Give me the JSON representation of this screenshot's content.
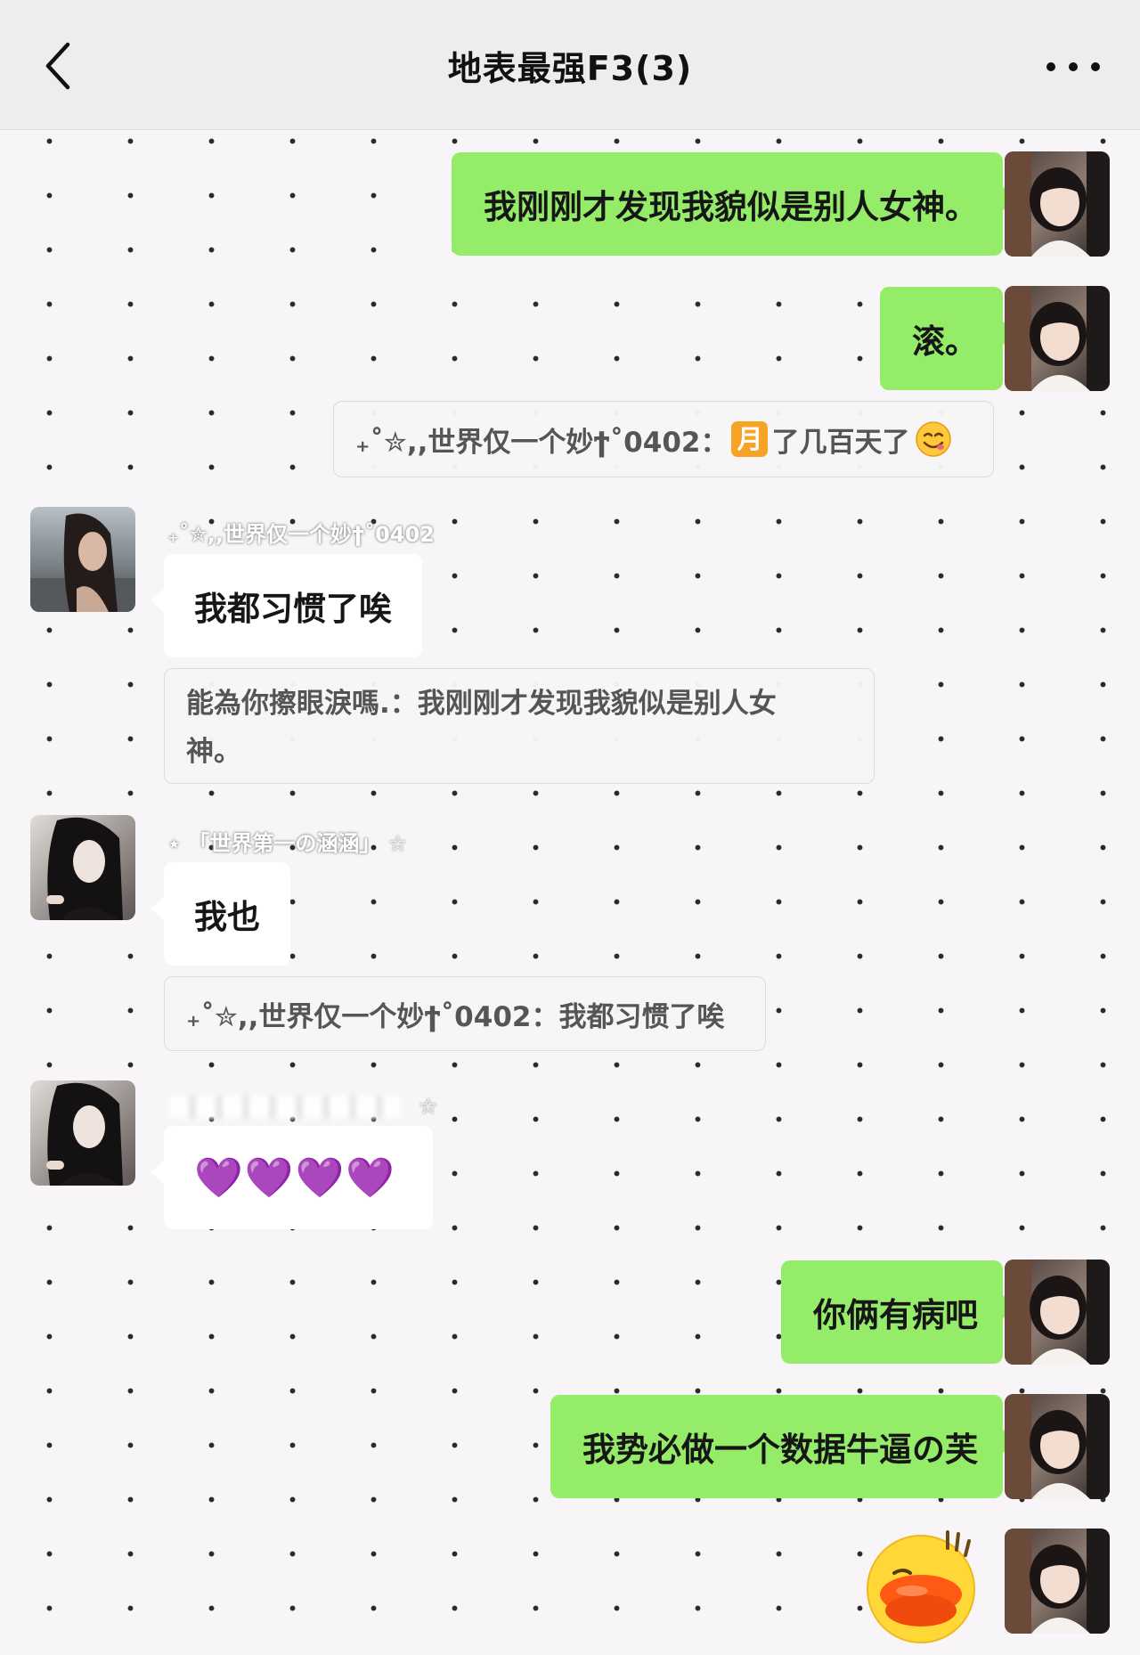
{
  "header": {
    "title": "地表最强F3(3)"
  },
  "messages": {
    "m1": {
      "text": "我刚刚才发现我貌似是别人女神。"
    },
    "m2": {
      "text": "滚。"
    },
    "m3": {
      "quote_prefix": "₊˚✮,,世界仅一个妙ϯ˚0402：",
      "quote_badge": "月",
      "quote_suffix": "了几百天了",
      "quote_emoji": "smiling-face-icon"
    },
    "m4": {
      "sender": "₊˚✮,,世界仅一个妙ϯ˚0402",
      "text": "我都习惯了唉",
      "quote": "能為你擦眼淚嗎.：我刚刚才发现我貌似是别人女神。"
    },
    "m5": {
      "sender": "⋆ 「世界第一の涵涵」 ☆",
      "text": "我也",
      "quote": "₊˚✮,,世界仅一个妙ϯ˚0402：我都习惯了唉"
    },
    "m6": {
      "sender_suffix": "☆",
      "text": "💜💜💜💜"
    },
    "m7": {
      "text": "你俩有病吧"
    },
    "m8": {
      "text": "我势必做一个数据牛逼の芙"
    },
    "m9": {
      "sticker": "duck-lips-sticker"
    }
  },
  "colors": {
    "header_bg": "#ededed",
    "my_bubble": "#95ec69",
    "other_bubble": "#ffffff",
    "hearts": "#9b42e6"
  }
}
